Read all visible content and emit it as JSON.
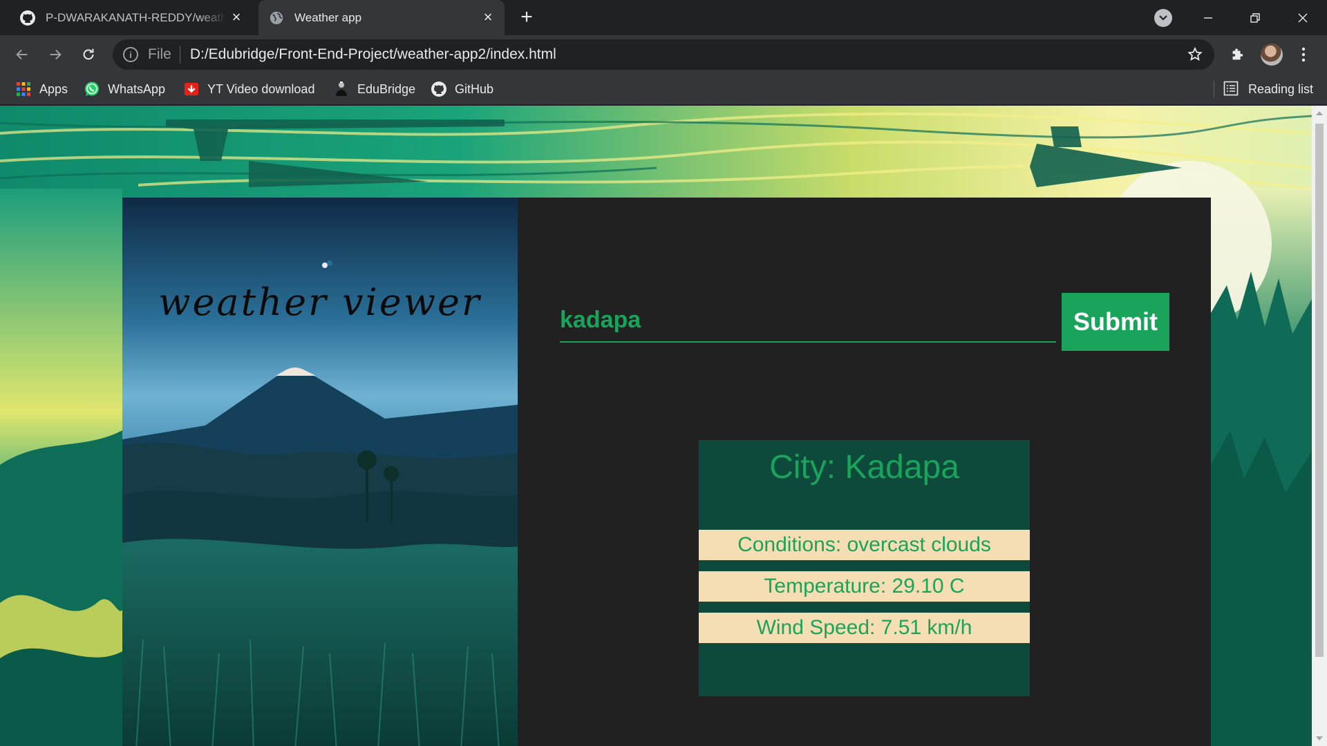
{
  "browser": {
    "tabs": [
      {
        "title": "P-DWARAKANATH-REDDY/weather-app",
        "active": false,
        "icon": "github-icon"
      },
      {
        "title": "Weather app",
        "active": true,
        "icon": "globe-icon"
      }
    ],
    "omnibox": {
      "scheme_label": "File",
      "url": "D:/Edubridge/Front-End-Project/weather-app2/index.html"
    },
    "bookmarks": [
      {
        "label": "Apps",
        "icon": "apps-grid-icon"
      },
      {
        "label": "WhatsApp",
        "icon": "whatsapp-icon"
      },
      {
        "label": "YT Video download",
        "icon": "download-icon"
      },
      {
        "label": "EduBridge",
        "icon": "edubridge-icon"
      },
      {
        "label": "GitHub",
        "icon": "github-icon"
      }
    ],
    "reading_list_label": "Reading list"
  },
  "app": {
    "title": "weather viewer",
    "search": {
      "value": "kadapa",
      "placeholder": ""
    },
    "submit_label": "Submit",
    "result": {
      "city": "City: Kadapa",
      "conditions": "Conditions: overcast clouds",
      "temperature": "Temperature: 29.10 C",
      "wind_speed": "Wind Speed: 7.51 km/h"
    }
  },
  "colors": {
    "accent_green": "#1aa35a",
    "result_panel": "#0e4a3b",
    "result_rows": "#f5deb3",
    "card_background": "#212121"
  }
}
